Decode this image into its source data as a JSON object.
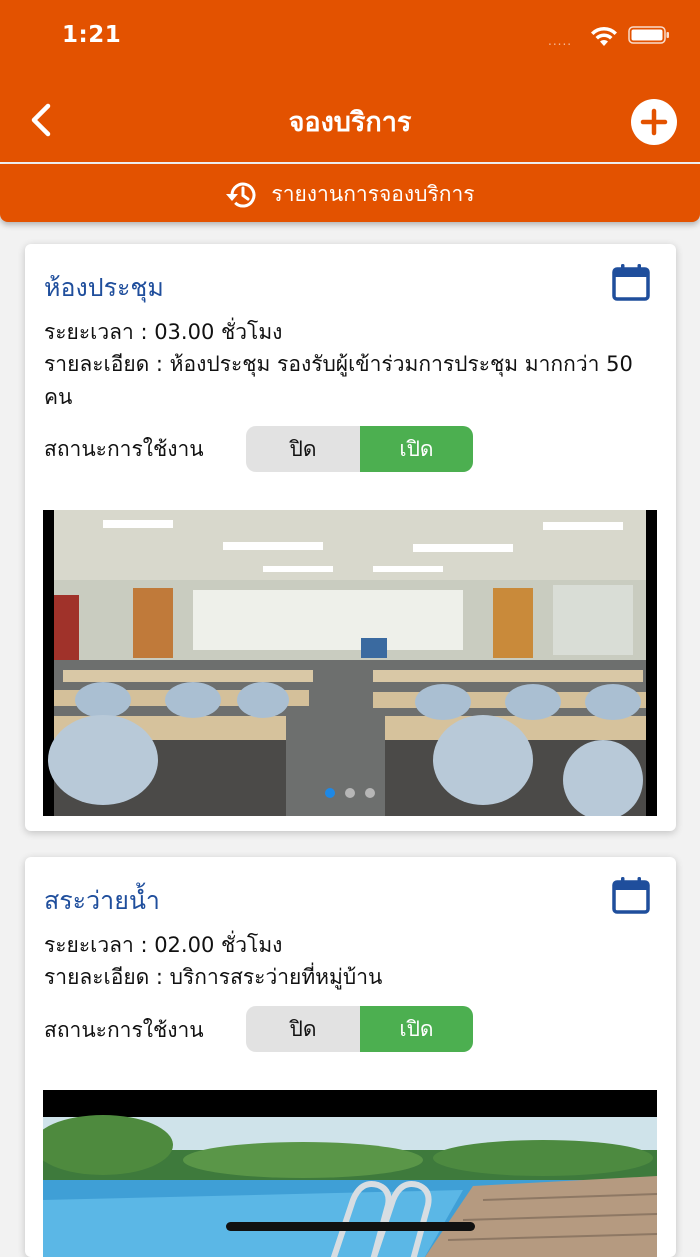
{
  "status_bar": {
    "time": "1:21",
    "signal": "....."
  },
  "nav": {
    "title": "จองบริการ"
  },
  "report_button": {
    "label": "รายงานการจองบริการ"
  },
  "colors": {
    "primary": "#e35200",
    "title_blue": "#1f4e9c",
    "toggle_on": "#4caf50",
    "toggle_off": "#e2e2e2"
  },
  "icons": {
    "back": "chevron-left-icon",
    "add": "plus-circle-icon",
    "history": "history-icon",
    "calendar": "calendar-icon"
  },
  "cards": [
    {
      "title": "ห้องประชุม",
      "duration": "ระยะเวลา : 03.00 ชั่วโมง",
      "details": "รายละเอียด : ห้องประชุม รองรับผู้เข้าร่วมการประชุม มากกว่า 50 คน",
      "status_label": "สถานะการใช้งาน",
      "toggle_off": "ปิด",
      "toggle_on": "เปิด",
      "selected": "เปิด",
      "image": "meeting-room-photo"
    },
    {
      "title": "สระว่ายน้ำ",
      "duration": "ระยะเวลา : 02.00 ชั่วโมง",
      "details": "รายละเอียด : บริการสระว่ายที่หมู่บ้าน",
      "status_label": "สถานะการใช้งาน",
      "toggle_off": "ปิด",
      "toggle_on": "เปิด",
      "selected": "เปิด",
      "image": "swimming-pool-photo"
    }
  ]
}
